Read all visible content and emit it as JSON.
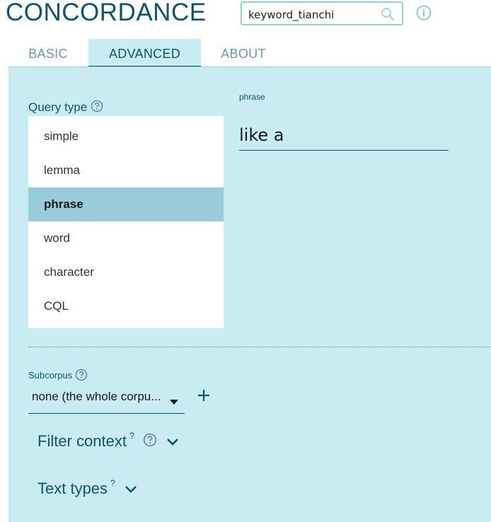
{
  "app": {
    "title": "CONCORDANCE"
  },
  "search": {
    "value": "keyword_tianchi",
    "icon": "search-icon"
  },
  "header": {
    "info_icon": "info-icon"
  },
  "tabs": [
    {
      "label": "BASIC",
      "active": false
    },
    {
      "label": "ADVANCED",
      "active": true
    },
    {
      "label": "ABOUT",
      "active": false
    }
  ],
  "query_type": {
    "label": "Query type",
    "options": [
      "simple",
      "lemma",
      "phrase",
      "word",
      "character",
      "CQL"
    ],
    "selected": "phrase"
  },
  "phrase": {
    "label": "phrase",
    "value": "like a"
  },
  "subcorpus": {
    "label": "Subcorpus",
    "value": "none (the whole corpu..."
  },
  "filter_context": {
    "label": "Filter context",
    "sup": "?"
  },
  "text_types": {
    "label": "Text types",
    "sup": "?"
  },
  "colors": {
    "accent": "#0e5470",
    "panel": "#c9ebf2",
    "selected": "#99ccdb"
  }
}
